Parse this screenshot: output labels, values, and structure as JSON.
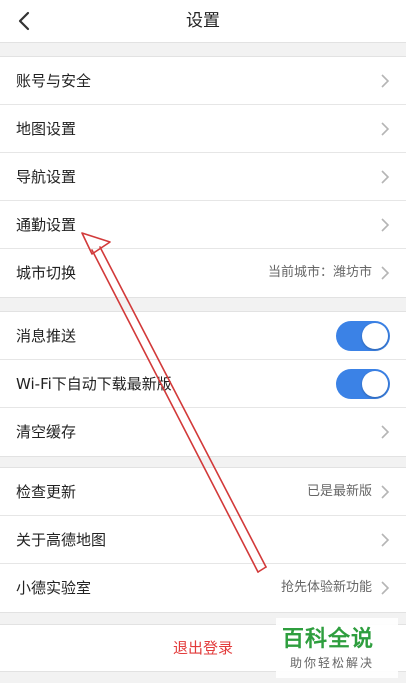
{
  "header": {
    "title": "设置",
    "back_icon": "chevron-left-icon"
  },
  "group1": {
    "items": [
      {
        "label": "账号与安全"
      },
      {
        "label": "地图设置"
      },
      {
        "label": "导航设置"
      },
      {
        "label": "通勤设置"
      },
      {
        "label": "城市切换",
        "value": "当前城市：潍坊市"
      }
    ]
  },
  "group2": {
    "items": [
      {
        "label": "消息推送",
        "toggle_on": true
      },
      {
        "label": "Wi-Fi下自动下载最新版",
        "toggle_on": true
      },
      {
        "label": "清空缓存"
      }
    ]
  },
  "group3": {
    "items": [
      {
        "label": "检查更新",
        "value": "已是最新版"
      },
      {
        "label": "关于高德地图"
      },
      {
        "label": "小德实验室",
        "value": "抢先体验新功能"
      }
    ]
  },
  "logout": {
    "label": "退出登录"
  },
  "watermark": {
    "main": "百科全说",
    "sub": "助你轻松解决"
  },
  "colors": {
    "accent": "#3b82e6",
    "logout_text": "#e23b3b",
    "annotation_arrow": "#d23a3a",
    "watermark_green": "#2e9e3e"
  }
}
